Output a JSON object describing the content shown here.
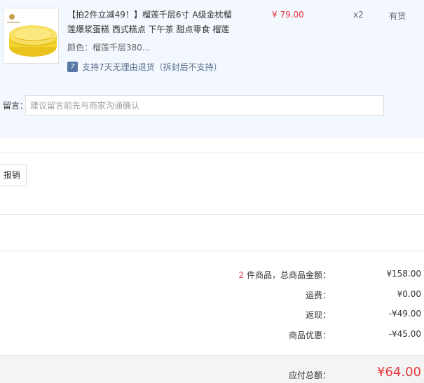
{
  "product": {
    "title": "【拍2件立减49！】榴莲千层6寸 A级金枕榴莲爆浆蛋糕 西式糕点 下午茶 甜点零食 榴莲",
    "price": "¥ 79.00",
    "quantity": "x2",
    "stock": "有货",
    "color": "颜色：榴莲千层380...",
    "return_policy": "支持7天无理由退货（拆封后不支持）",
    "return_icon_text": "7"
  },
  "remark": {
    "label": "留言：",
    "placeholder": "建议留言前先与商家沟通确认"
  },
  "invoice": {
    "button_label": "报销"
  },
  "summary": {
    "count": "2",
    "items_label": " 件商品，总商品金额：",
    "items_total": "¥158.00",
    "shipping_label": "运费：",
    "shipping_value": "¥0.00",
    "rebate_label": "返现：",
    "rebate_value": "-¥49.00",
    "discount_label": "商品优惠：",
    "discount_value": "-¥45.00",
    "payable_label": "应付总额：",
    "payable_value": "¥64.00"
  },
  "colors": {
    "accent_red": "#e4393c",
    "panel_bg": "#f3f8fe"
  }
}
